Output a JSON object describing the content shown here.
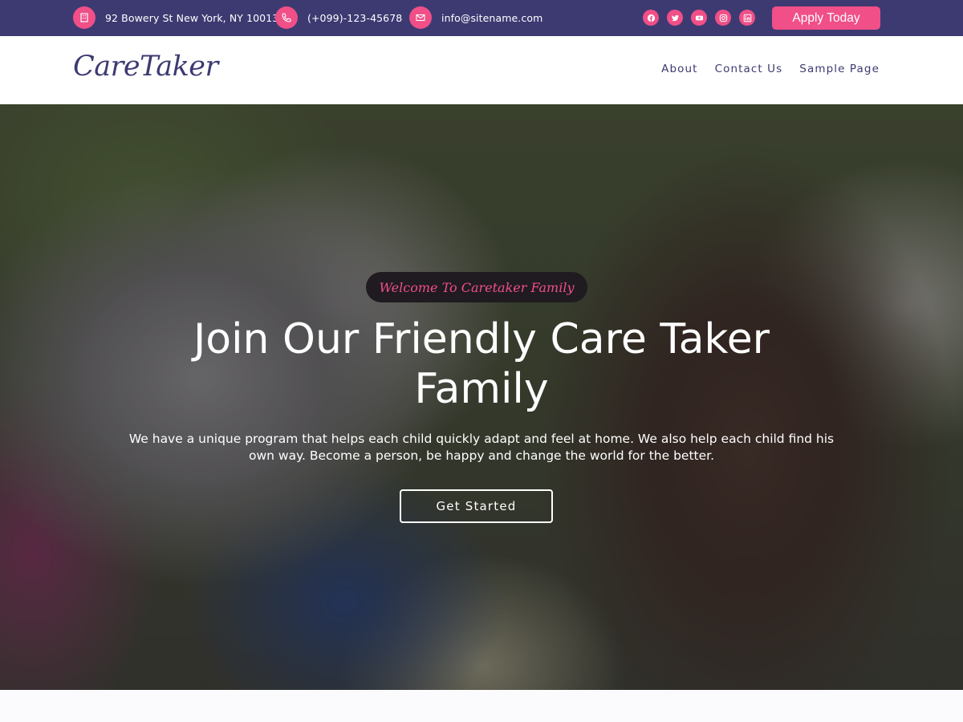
{
  "topbar": {
    "address": "92 Bowery St New York, NY 10013",
    "phone": "(+099)-123-45678",
    "email": "info@sitename.com",
    "socials": [
      "facebook-icon",
      "twitter-icon",
      "youtube-icon",
      "instagram-icon",
      "linkedin-icon"
    ],
    "apply_label": "Apply Today"
  },
  "header": {
    "logo": "CareTaker",
    "nav": [
      "About",
      "Contact Us",
      "Sample Page"
    ]
  },
  "hero": {
    "welcome": "Welcome To Caretaker Family",
    "title": "Join Our Friendly Care Taker Family",
    "description": "We have a unique program that helps each child quickly adapt and feel at home. We also help each child find his own way. Become a person, be happy and change the world for the better.",
    "cta_label": "Get Started"
  },
  "colors": {
    "primary": "#3d3a72",
    "accent": "#f04f87"
  }
}
